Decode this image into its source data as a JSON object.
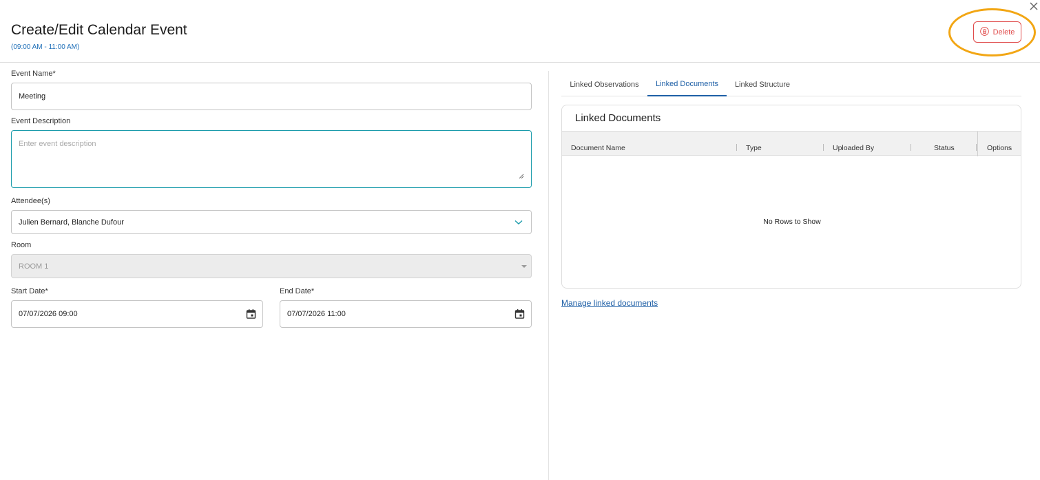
{
  "header": {
    "title": "Create/Edit Calendar Event",
    "time_range": "(09:00 AM - 11:00 AM)",
    "delete_label": "Delete"
  },
  "form": {
    "event_name": {
      "label": "Event Name*",
      "value": "Meeting"
    },
    "event_description": {
      "label": "Event Description",
      "placeholder": "Enter event description",
      "value": ""
    },
    "attendees": {
      "label": "Attendee(s)",
      "value": "Julien Bernard, Blanche Dufour"
    },
    "room": {
      "label": "Room",
      "value": "ROOM 1",
      "disabled": true
    },
    "start_date": {
      "label": "Start Date*",
      "value": "07/07/2026 09:00"
    },
    "end_date": {
      "label": "End Date*",
      "value": "07/07/2026 11:00"
    }
  },
  "tabs": [
    {
      "label": "Linked Observations",
      "active": false
    },
    {
      "label": "Linked Documents",
      "active": true
    },
    {
      "label": "Linked Structure",
      "active": false
    }
  ],
  "linked_documents": {
    "title": "Linked Documents",
    "columns": [
      "Document Name",
      "Type",
      "Uploaded By",
      "Status",
      "Options"
    ],
    "rows": [],
    "empty_message": "No Rows to Show",
    "manage_link": "Manage linked documents"
  },
  "icons": {
    "close": "close-icon",
    "delete": "trash-icon",
    "dropdown": "chevron-down-icon",
    "date": "calendar-icon"
  },
  "colors": {
    "accent_blue": "#1e5fa6",
    "focus_teal": "#1a9bab",
    "danger_red": "#e04b4b",
    "highlight_orange": "#f2a614"
  }
}
